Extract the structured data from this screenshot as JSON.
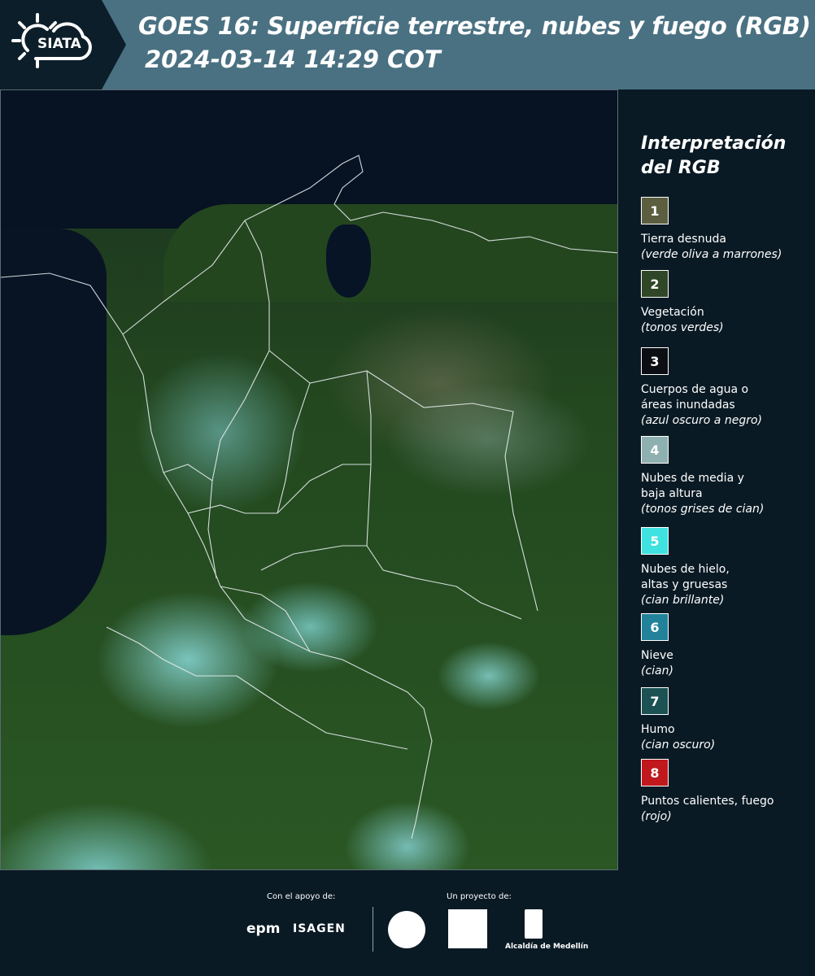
{
  "header": {
    "logo_text": "SIATA",
    "title": "GOES 16: Superficie terrestre, nubes y fuego (RGB)",
    "datetime": "2024-03-14 14:29 COT"
  },
  "legend": {
    "title_line1": "Interpretación",
    "title_line2": "del RGB",
    "items": [
      {
        "number": "1",
        "color": "#5b5f40",
        "label_line1": "Tierra desnuda",
        "label_line2": "",
        "desc": "(verde oliva a marrones)"
      },
      {
        "number": "2",
        "color": "#2f4726",
        "label_line1": "Vegetación",
        "label_line2": "",
        "desc": "(tonos verdes)"
      },
      {
        "number": "3",
        "color": "#0b0f14",
        "label_line1": "Cuerpos de agua o",
        "label_line2": "áreas inundadas",
        "desc": "(azul oscuro a negro)"
      },
      {
        "number": "4",
        "color": "#8fb0b0",
        "label_line1": "Nubes de media y",
        "label_line2": "baja altura",
        "desc": "(tonos grises de cian)"
      },
      {
        "number": "5",
        "color": "#3fe2e0",
        "label_line1": "Nubes de hielo,",
        "label_line2": "altas y gruesas",
        "desc": "(cian brillante)"
      },
      {
        "number": "6",
        "color": "#22829a",
        "label_line1": "Nieve",
        "label_line2": "",
        "desc": "(cian)"
      },
      {
        "number": "7",
        "color": "#1d5254",
        "label_line1": "Humo",
        "label_line2": "",
        "desc": "(cian oscuro)"
      },
      {
        "number": "8",
        "color": "#c0181d",
        "label_line1": "Puntos calientes, fuego",
        "label_line2": "",
        "desc": "(rojo)"
      }
    ]
  },
  "footer": {
    "apoyo_label": "Con el apoyo de:",
    "proyecto_label": "Un proyecto de:",
    "epm": "epm",
    "isagen": "ISAGEN",
    "alcaldia": "Alcaldía de Medellín"
  }
}
